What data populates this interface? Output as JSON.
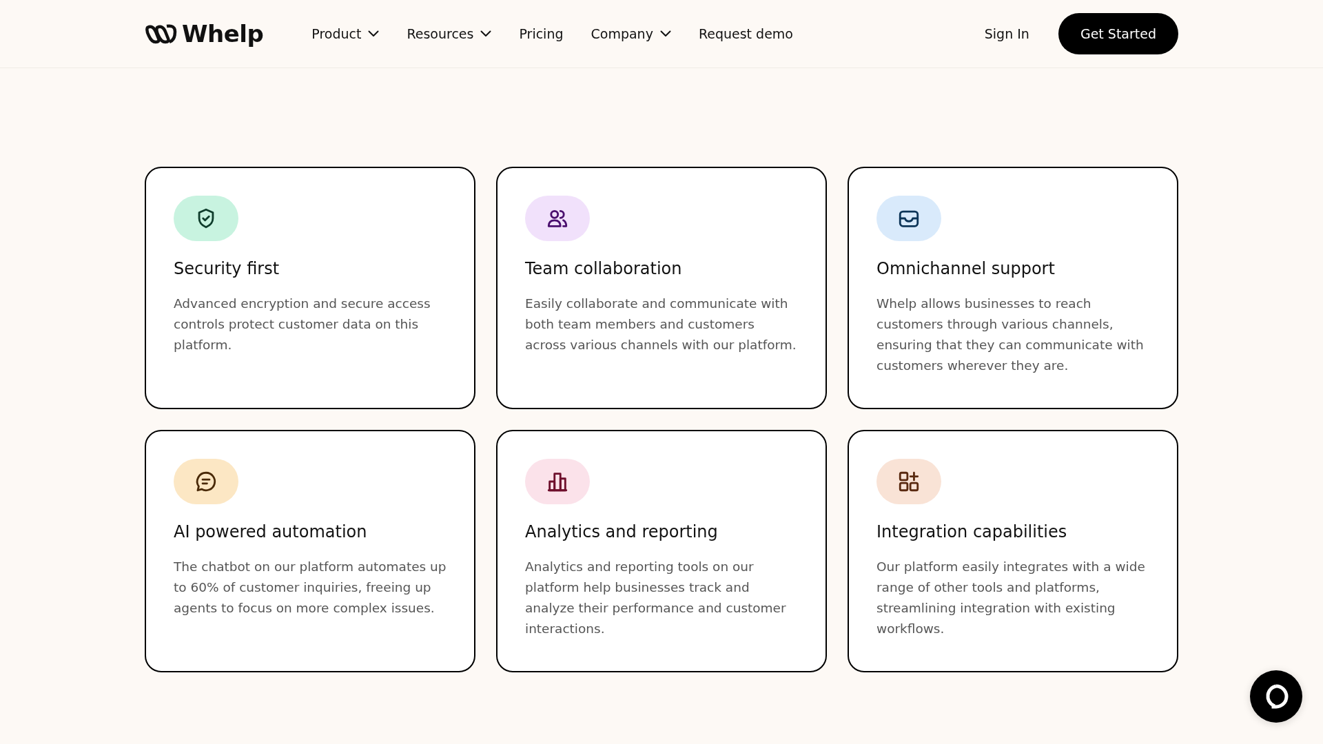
{
  "header": {
    "logo": "Whelp",
    "nav": [
      {
        "label": "Product",
        "dropdown": true
      },
      {
        "label": "Resources",
        "dropdown": true
      },
      {
        "label": "Pricing",
        "dropdown": false
      },
      {
        "label": "Company",
        "dropdown": true
      },
      {
        "label": "Request demo",
        "dropdown": false
      }
    ],
    "sign_in": "Sign In",
    "cta": "Get Started"
  },
  "features": [
    {
      "title": "Security first",
      "text": "Advanced encryption and secure access controls protect customer data on this platform.",
      "color": "#c8f3e0"
    },
    {
      "title": "Team collaboration",
      "text": "Easily collaborate and communicate with both team members and customers across various channels with our platform.",
      "color": "#f1e1fb"
    },
    {
      "title": "Omnichannel support",
      "text": "Whelp allows businesses to reach customers through various channels, ensuring that they can communicate with customers wherever they are.",
      "color": "#d9eafb"
    },
    {
      "title": "AI powered automation",
      "text": "The chatbot on our platform automates up to 60% of customer inquiries, freeing up agents to focus on more complex issues.",
      "color": "#fce7c4"
    },
    {
      "title": "Analytics and reporting",
      "text": "Analytics and reporting tools on our platform help businesses track and analyze their performance and customer interactions.",
      "color": "#fbe2ea"
    },
    {
      "title": "Integration capabilities",
      "text": "Our platform easily integrates with a wide range of other tools and platforms, streamlining integration with existing workflows.",
      "color": "#f9e3d6"
    }
  ]
}
